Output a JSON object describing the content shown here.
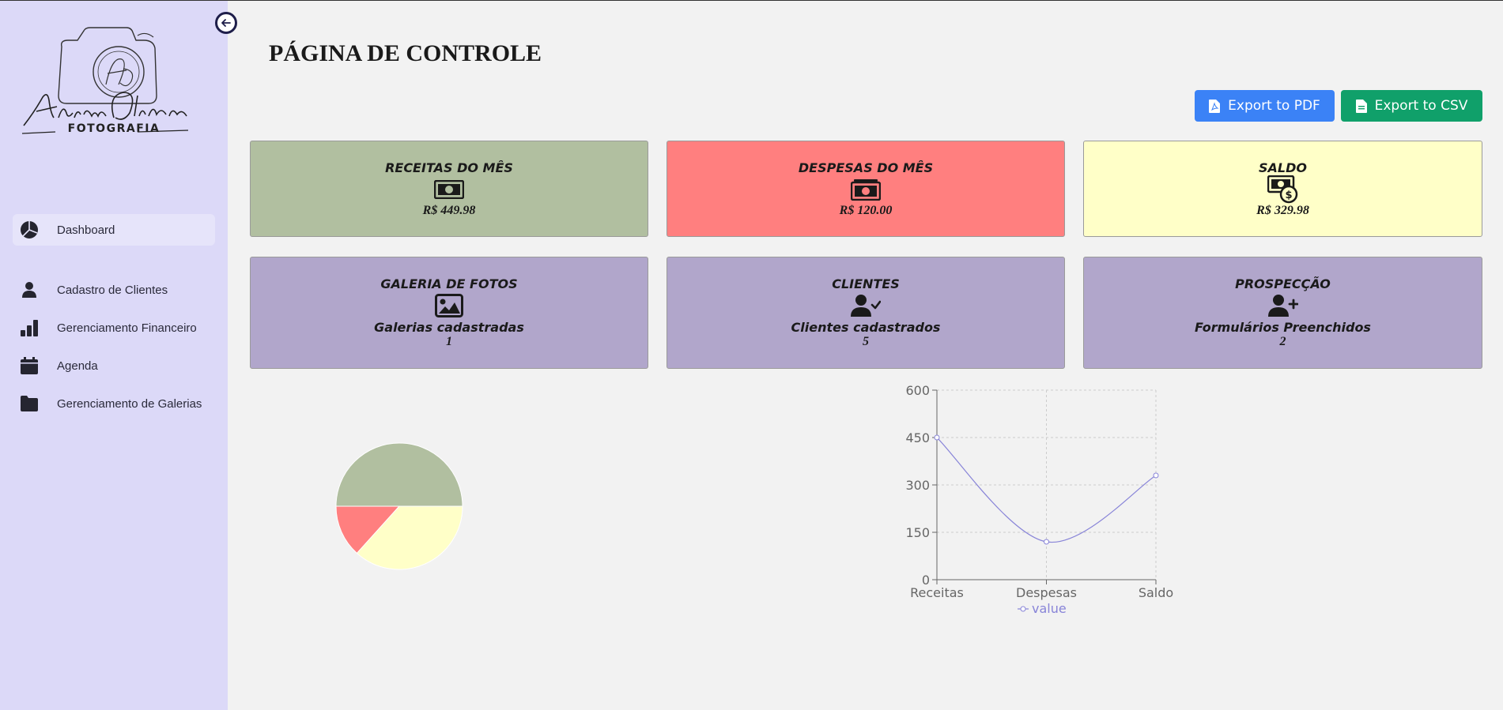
{
  "sidebar": {
    "logo_script": "Adriana Oliveira",
    "logo_sub": "FOTOGRAFIA",
    "items": [
      {
        "label": "Dashboard",
        "icon": "pie-chart-icon"
      },
      {
        "label": "Cadastro de Clientes",
        "icon": "user-icon"
      },
      {
        "label": "Gerenciamento Financeiro",
        "icon": "bar-chart-icon"
      },
      {
        "label": "Agenda",
        "icon": "calendar-icon"
      },
      {
        "label": "Gerenciamento de Galerias",
        "icon": "folder-icon"
      }
    ]
  },
  "header": {
    "title": "PÁGINA DE CONTROLE",
    "export_pdf": "Export to PDF",
    "export_csv": "Export to CSV"
  },
  "cards": {
    "receitas": {
      "title": "RECEITAS DO MÊS",
      "value": "R$ 449.98",
      "color": "#b1bfa0"
    },
    "despesas": {
      "title": "DESPESAS DO MÊS",
      "value": "R$ 120.00",
      "color": "#ff7f7f"
    },
    "saldo": {
      "title": "SALDO",
      "value": "R$ 329.98",
      "color": "#ffffc8"
    },
    "galeria": {
      "title": "GALERIA DE FOTOS",
      "subtitle": "Galerias cadastradas",
      "value": "1",
      "color": "#b1a6cb"
    },
    "clientes": {
      "title": "CLIENTES",
      "subtitle": "Clientes cadastrados",
      "value": "5",
      "color": "#b1a6cb"
    },
    "prospeccao": {
      "title": "PROSPECÇÃO",
      "subtitle": "Formulários Preenchidos",
      "value": "2",
      "color": "#b1a6cb"
    }
  },
  "chart_data": [
    {
      "type": "pie",
      "categories": [
        "Receitas",
        "Despesas",
        "Saldo"
      ],
      "values": [
        449.98,
        120.0,
        329.98
      ],
      "colors": [
        "#b1bfa0",
        "#ff7f7f",
        "#ffffc8"
      ]
    },
    {
      "type": "line",
      "categories": [
        "Receitas",
        "Despesas",
        "Saldo"
      ],
      "series": [
        {
          "name": "value",
          "values": [
            449.98,
            120.0,
            329.98
          ]
        }
      ],
      "yticks": [
        "0",
        "150",
        "300",
        "450",
        "600"
      ],
      "ylim": [
        0,
        600
      ],
      "grid": true,
      "legend": "bottom",
      "line_color": "#8884d8"
    }
  ]
}
